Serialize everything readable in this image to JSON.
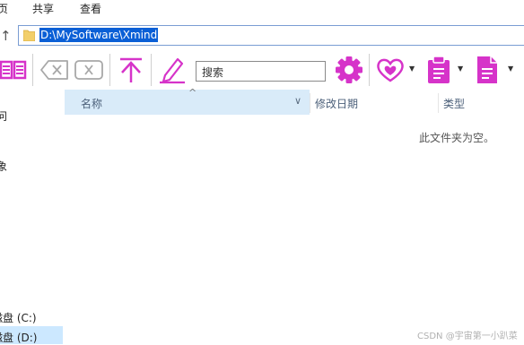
{
  "menubar": {
    "items": [
      "页",
      "共享",
      "查看"
    ]
  },
  "address": {
    "path": "D:\\MySoftware\\Xmind",
    "up_icon": "↑"
  },
  "toolbar": {
    "search_text": "搜索",
    "dropdown_glyph": "▼",
    "accent_color": "#d633c9"
  },
  "columns": {
    "name": "名称",
    "modified": "修改日期",
    "type": "类型",
    "sort_glyph": "^",
    "dropdown_glyph": "∨"
  },
  "content": {
    "empty_message": "此文件夹为空。"
  },
  "nav": {
    "items": [
      "问",
      "象",
      "磁盘 (C:)",
      "磁盘 (D:)"
    ]
  },
  "watermark": "CSDN @宇宙第一小趴菜"
}
